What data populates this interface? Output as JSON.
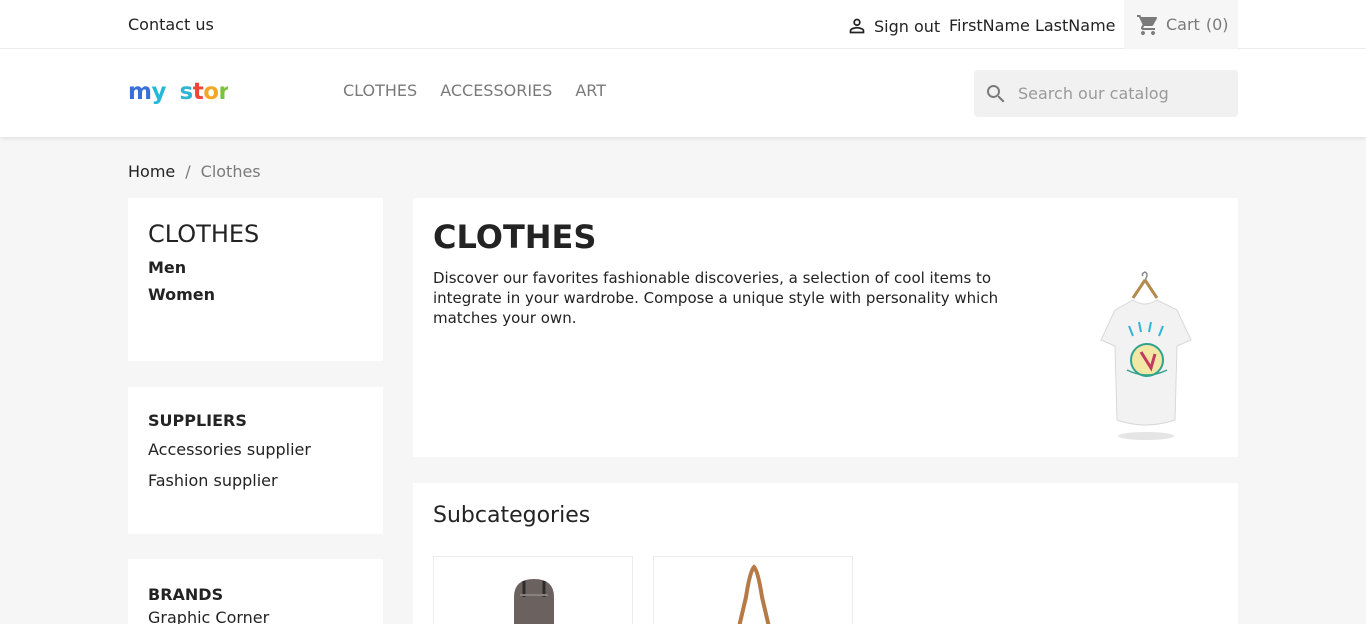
{
  "topbar": {
    "contact": "Contact us",
    "signout": "Sign out",
    "username": "FirstName LastName",
    "cart_label": "Cart",
    "cart_count": "(0)"
  },
  "header": {
    "logo_text": "my store",
    "nav": [
      "CLOTHES",
      "ACCESSORIES",
      "ART"
    ],
    "search_placeholder": "Search our catalog"
  },
  "breadcrumb": {
    "home": "Home",
    "separator": "/",
    "current": "Clothes"
  },
  "sidebar": {
    "category_title": "CLOTHES",
    "category_links": [
      "Men",
      "Women"
    ],
    "suppliers_title": "SUPPLIERS",
    "suppliers": [
      "Accessories supplier",
      "Fashion supplier"
    ],
    "brands_title": "BRANDS",
    "brands": [
      "Graphic Corner"
    ]
  },
  "main": {
    "title": "CLOTHES",
    "description": "Discover our favorites fashionable discoveries, a selection of cool items to integrate in your wardrobe. Compose a unique style with personality which matches your own.",
    "subcategories_title": "Subcategories"
  },
  "colors": {
    "accent": "#24b9d7",
    "background": "#f6f6f6",
    "text": "#232323",
    "muted": "#7a7a7a"
  }
}
